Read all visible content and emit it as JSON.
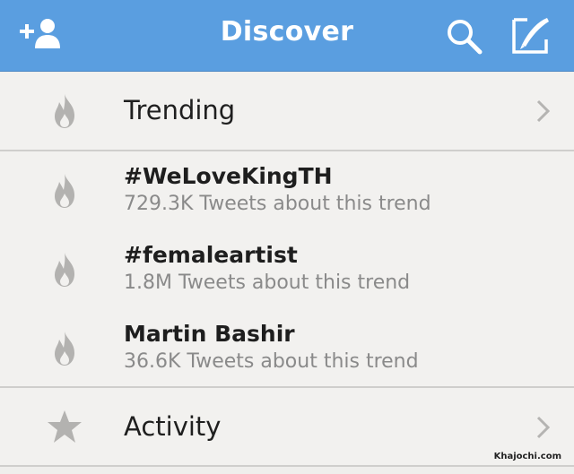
{
  "header": {
    "title": "Discover",
    "icons": {
      "add": "add-user-icon",
      "search": "search-icon",
      "compose": "compose-icon"
    },
    "bg_color": "#5a9ee0"
  },
  "sections": {
    "trending": {
      "label": "Trending",
      "icon": "flame-icon"
    },
    "activity": {
      "label": "Activity",
      "icon": "star-icon"
    }
  },
  "trends": [
    {
      "name": "#WeLoveKingTH",
      "meta": "729.3K Tweets about this trend"
    },
    {
      "name": "#femaleartist",
      "meta": "1.8M Tweets about this trend"
    },
    {
      "name": "Martin Bashir",
      "meta": "36.6K Tweets about this trend"
    }
  ],
  "watermark": "Khajochi.com"
}
